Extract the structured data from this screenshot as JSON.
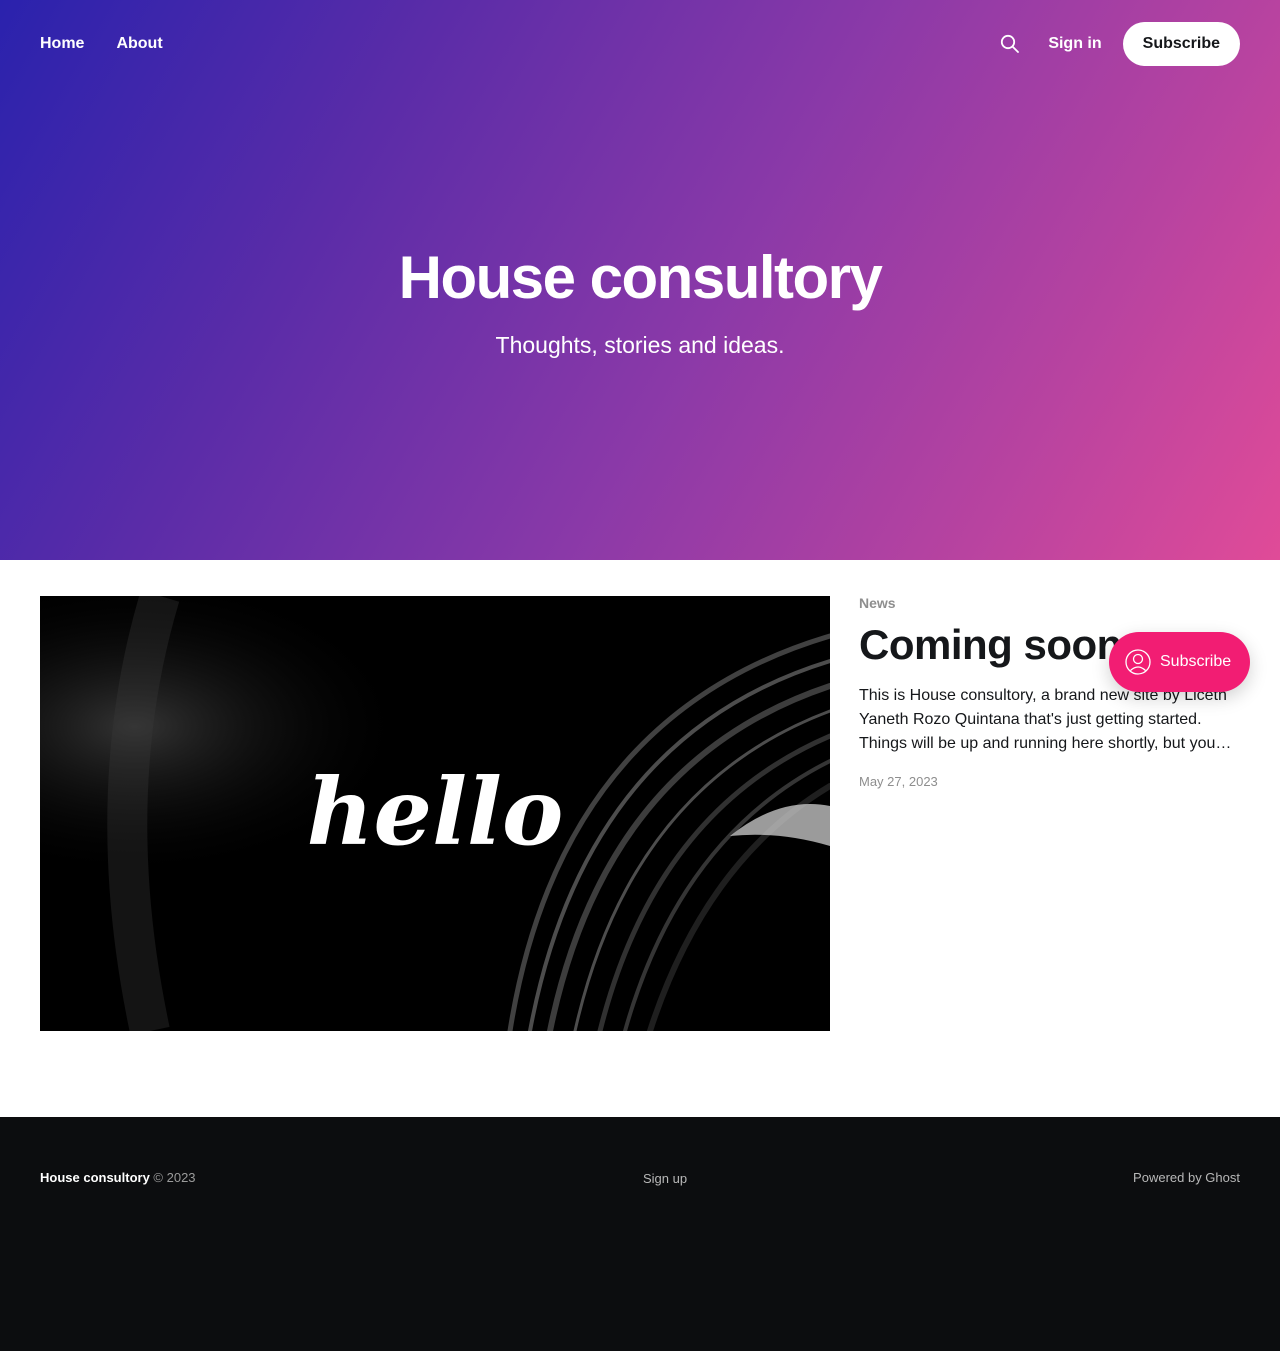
{
  "header": {
    "nav": [
      {
        "label": "Home"
      },
      {
        "label": "About"
      }
    ],
    "search_icon": "search-icon",
    "signin_label": "Sign in",
    "subscribe_label": "Subscribe"
  },
  "hero": {
    "title": "House consultory",
    "description": "Thoughts, stories and ideas.",
    "gradient_colors": [
      "#2a22ad",
      "#8a39a8",
      "#e04b98"
    ]
  },
  "featured_post": {
    "image_text": "hello",
    "tag": "News",
    "title": "Coming soon",
    "excerpt": "This is House consultory, a brand new site by Liceth Yaneth Rozo Quintana that's just getting started. Things will be up and running here shortly, but you…",
    "date": "May 27, 2023"
  },
  "portal": {
    "label": "Subscribe",
    "icon": "user-circle-icon",
    "color": "#f21d73"
  },
  "footer": {
    "brand": "House consultory",
    "copyright": "© 2023",
    "signup_label": "Sign up",
    "powered_label": "Powered by Ghost"
  }
}
